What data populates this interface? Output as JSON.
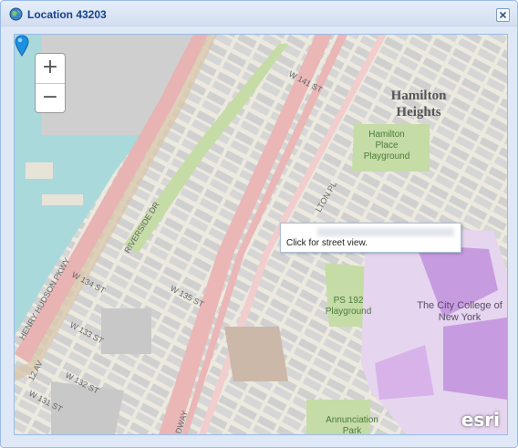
{
  "window": {
    "title": "Location 43203"
  },
  "map": {
    "zoom_in": "+",
    "zoom_out": "−",
    "attribution_logo": "esri",
    "popup": {
      "text": "Click for street view."
    },
    "labels": {
      "neighborhood_line1": "Hamilton",
      "neighborhood_line2": "Heights",
      "hamilton_place_1": "Hamilton",
      "hamilton_place_2": "Place",
      "hamilton_place_3": "Playground",
      "ps192_1": "PS 192",
      "ps192_2": "Playground",
      "ccny_1": "The City College of",
      "ccny_2": "New York",
      "annunciation_1": "Annunciation",
      "annunciation_2": "Park",
      "riverside_dr": "RIVERSIDE DR",
      "henry_hudson": "HENRY HUDSON PKWY",
      "w141": "W 141 ST",
      "w135": "W 135 ST",
      "w134": "W 134 ST",
      "w133": "W 133 ST",
      "w132": "W 132 ST",
      "w131": "W 131 ST",
      "ave12": "12 AV",
      "hamilton_pl": "LTON PL",
      "broadway": "DWAY"
    }
  },
  "colors": {
    "water": "#aad9db",
    "land": "#f0ede4",
    "park": "#c5dca6",
    "college": "#d3a6e8",
    "major_road": "#eab6b6",
    "block": "#cfcfcf"
  }
}
